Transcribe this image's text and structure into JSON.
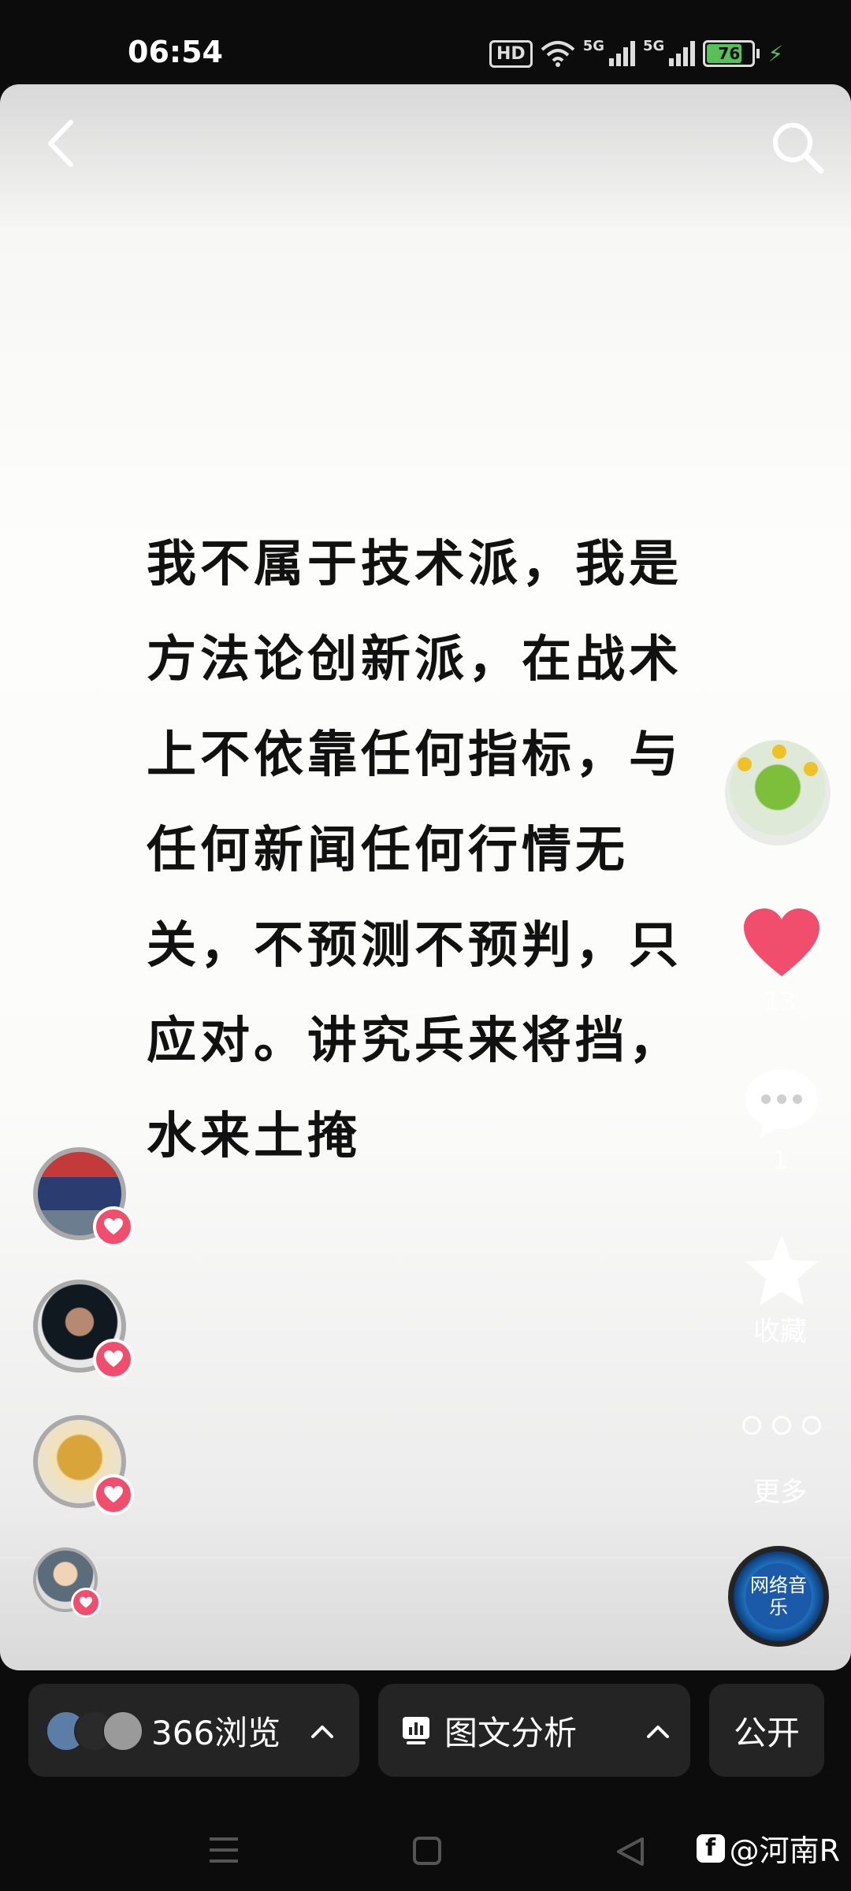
{
  "status_bar": {
    "time": "06:54",
    "hd_label": "HD",
    "network_1": "5G",
    "network_2": "5G",
    "battery": "76"
  },
  "post": {
    "text": "我不属于技术派，我是\n方法论创新派，在战术\n上不依靠任何指标，与\n任何新闻任何行情无\n关，不预测不预判，只\n应对。讲究兵来将挡，\n水来土掩"
  },
  "actions": {
    "like_count": "13",
    "comment_count": "1",
    "collect_label": "收藏",
    "more_label": "更多",
    "music_label": "网络音乐"
  },
  "bottom": {
    "views_label": "366浏览",
    "analysis_label": "图文分析",
    "public_label": "公开"
  },
  "watermark": {
    "text": "@河南R"
  },
  "icons": {
    "back": "back-arrow-icon",
    "search": "search-icon",
    "like": "heart-icon",
    "comment": "comment-bubble-icon",
    "collect": "star-icon",
    "more": "more-dots-icon",
    "analysis": "bar-chart-icon"
  },
  "colors": {
    "like_red": "#f04e6c",
    "pill_bg": "#242424",
    "battery_green": "#56c156"
  }
}
